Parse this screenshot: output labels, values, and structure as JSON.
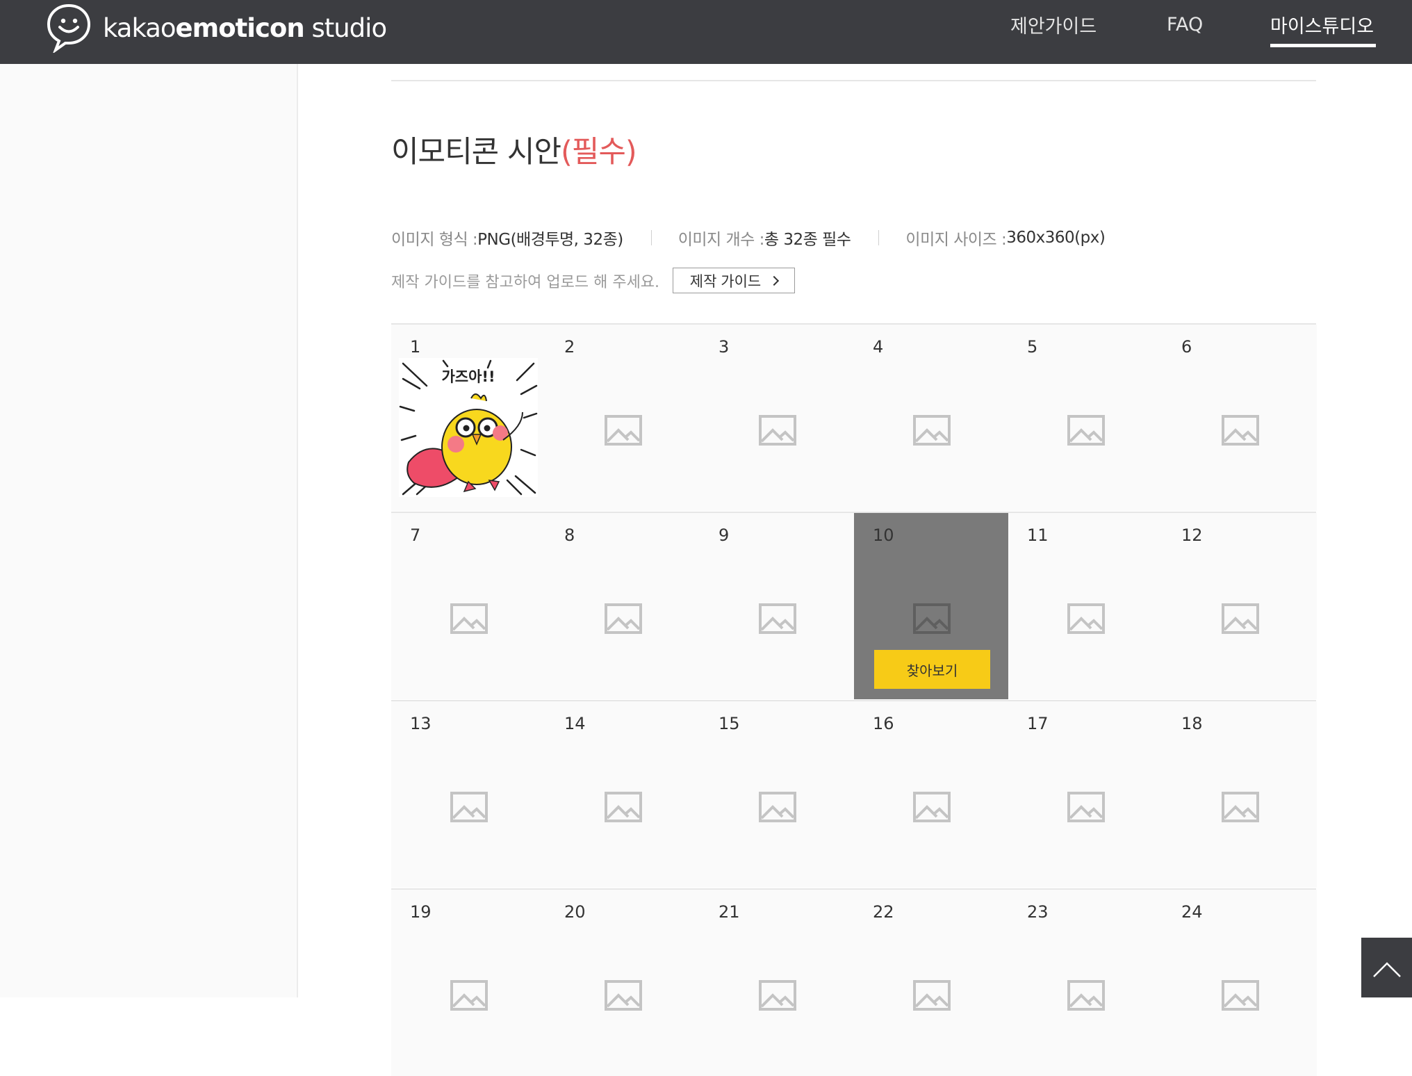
{
  "brand": {
    "prefix": "kakao",
    "bold": "emoticon",
    "suffix": " studio"
  },
  "nav": {
    "guide": "제안가이드",
    "faq": "FAQ",
    "studio": "마이스튜디오"
  },
  "section": {
    "title": "이모티콘 시안",
    "required": "(필수)"
  },
  "spec": {
    "format_label": "이미지 형식 : ",
    "format_value": "PNG(배경투명, 32종)",
    "count_label": "이미지 개수 : ",
    "count_value": "총 32종 필수",
    "size_label": "이미지 사이즈 : ",
    "size_value": "360x360(px)"
  },
  "hint": "제작 가이드를 참고하여 업로드 해 주세요.",
  "guide_button": "제작 가이드",
  "find_button": "찾아보기",
  "emoticon_text": "가즈아!!",
  "slots": [
    "1",
    "2",
    "3",
    "4",
    "5",
    "6",
    "7",
    "8",
    "9",
    "10",
    "11",
    "12",
    "13",
    "14",
    "15",
    "16",
    "17",
    "18",
    "19",
    "20",
    "21",
    "22",
    "23",
    "24"
  ],
  "filled_slot": "1",
  "active_slot": "10",
  "colors": {
    "header": "#3c3d41",
    "accent": "#f7cb17",
    "required": "#e35a5a"
  }
}
